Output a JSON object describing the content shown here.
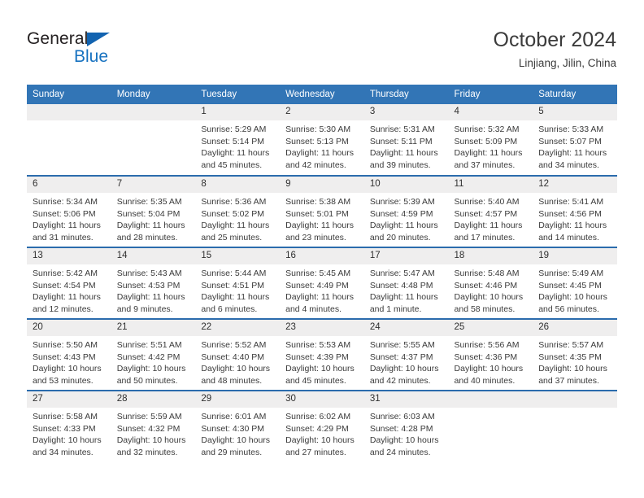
{
  "brand": {
    "name_part1": "General",
    "name_part2": "Blue",
    "colors": {
      "dark": "#231f20",
      "blue": "#1772c0",
      "triangle": "#1263b0"
    }
  },
  "header": {
    "title": "October 2024",
    "subtitle": "Linjiang, Jilin, China"
  },
  "theme": {
    "header_blue": "#3275b6",
    "row_divider_blue": "#2b6cad",
    "daynum_band": "#efeeee",
    "text": "#3a3a3a"
  },
  "weekday_headers": [
    "Sunday",
    "Monday",
    "Tuesday",
    "Wednesday",
    "Thursday",
    "Friday",
    "Saturday"
  ],
  "weeks": [
    [
      {
        "day": "",
        "sunrise": "",
        "sunset": "",
        "daylight1": "",
        "daylight2": "",
        "blank": true
      },
      {
        "day": "",
        "sunrise": "",
        "sunset": "",
        "daylight1": "",
        "daylight2": "",
        "blank": true
      },
      {
        "day": "1",
        "sunrise": "Sunrise: 5:29 AM",
        "sunset": "Sunset: 5:14 PM",
        "daylight1": "Daylight: 11 hours",
        "daylight2": "and 45 minutes."
      },
      {
        "day": "2",
        "sunrise": "Sunrise: 5:30 AM",
        "sunset": "Sunset: 5:13 PM",
        "daylight1": "Daylight: 11 hours",
        "daylight2": "and 42 minutes."
      },
      {
        "day": "3",
        "sunrise": "Sunrise: 5:31 AM",
        "sunset": "Sunset: 5:11 PM",
        "daylight1": "Daylight: 11 hours",
        "daylight2": "and 39 minutes."
      },
      {
        "day": "4",
        "sunrise": "Sunrise: 5:32 AM",
        "sunset": "Sunset: 5:09 PM",
        "daylight1": "Daylight: 11 hours",
        "daylight2": "and 37 minutes."
      },
      {
        "day": "5",
        "sunrise": "Sunrise: 5:33 AM",
        "sunset": "Sunset: 5:07 PM",
        "daylight1": "Daylight: 11 hours",
        "daylight2": "and 34 minutes."
      }
    ],
    [
      {
        "day": "6",
        "sunrise": "Sunrise: 5:34 AM",
        "sunset": "Sunset: 5:06 PM",
        "daylight1": "Daylight: 11 hours",
        "daylight2": "and 31 minutes."
      },
      {
        "day": "7",
        "sunrise": "Sunrise: 5:35 AM",
        "sunset": "Sunset: 5:04 PM",
        "daylight1": "Daylight: 11 hours",
        "daylight2": "and 28 minutes."
      },
      {
        "day": "8",
        "sunrise": "Sunrise: 5:36 AM",
        "sunset": "Sunset: 5:02 PM",
        "daylight1": "Daylight: 11 hours",
        "daylight2": "and 25 minutes."
      },
      {
        "day": "9",
        "sunrise": "Sunrise: 5:38 AM",
        "sunset": "Sunset: 5:01 PM",
        "daylight1": "Daylight: 11 hours",
        "daylight2": "and 23 minutes."
      },
      {
        "day": "10",
        "sunrise": "Sunrise: 5:39 AM",
        "sunset": "Sunset: 4:59 PM",
        "daylight1": "Daylight: 11 hours",
        "daylight2": "and 20 minutes."
      },
      {
        "day": "11",
        "sunrise": "Sunrise: 5:40 AM",
        "sunset": "Sunset: 4:57 PM",
        "daylight1": "Daylight: 11 hours",
        "daylight2": "and 17 minutes."
      },
      {
        "day": "12",
        "sunrise": "Sunrise: 5:41 AM",
        "sunset": "Sunset: 4:56 PM",
        "daylight1": "Daylight: 11 hours",
        "daylight2": "and 14 minutes."
      }
    ],
    [
      {
        "day": "13",
        "sunrise": "Sunrise: 5:42 AM",
        "sunset": "Sunset: 4:54 PM",
        "daylight1": "Daylight: 11 hours",
        "daylight2": "and 12 minutes."
      },
      {
        "day": "14",
        "sunrise": "Sunrise: 5:43 AM",
        "sunset": "Sunset: 4:53 PM",
        "daylight1": "Daylight: 11 hours",
        "daylight2": "and 9 minutes."
      },
      {
        "day": "15",
        "sunrise": "Sunrise: 5:44 AM",
        "sunset": "Sunset: 4:51 PM",
        "daylight1": "Daylight: 11 hours",
        "daylight2": "and 6 minutes."
      },
      {
        "day": "16",
        "sunrise": "Sunrise: 5:45 AM",
        "sunset": "Sunset: 4:49 PM",
        "daylight1": "Daylight: 11 hours",
        "daylight2": "and 4 minutes."
      },
      {
        "day": "17",
        "sunrise": "Sunrise: 5:47 AM",
        "sunset": "Sunset: 4:48 PM",
        "daylight1": "Daylight: 11 hours",
        "daylight2": "and 1 minute."
      },
      {
        "day": "18",
        "sunrise": "Sunrise: 5:48 AM",
        "sunset": "Sunset: 4:46 PM",
        "daylight1": "Daylight: 10 hours",
        "daylight2": "and 58 minutes."
      },
      {
        "day": "19",
        "sunrise": "Sunrise: 5:49 AM",
        "sunset": "Sunset: 4:45 PM",
        "daylight1": "Daylight: 10 hours",
        "daylight2": "and 56 minutes."
      }
    ],
    [
      {
        "day": "20",
        "sunrise": "Sunrise: 5:50 AM",
        "sunset": "Sunset: 4:43 PM",
        "daylight1": "Daylight: 10 hours",
        "daylight2": "and 53 minutes."
      },
      {
        "day": "21",
        "sunrise": "Sunrise: 5:51 AM",
        "sunset": "Sunset: 4:42 PM",
        "daylight1": "Daylight: 10 hours",
        "daylight2": "and 50 minutes."
      },
      {
        "day": "22",
        "sunrise": "Sunrise: 5:52 AM",
        "sunset": "Sunset: 4:40 PM",
        "daylight1": "Daylight: 10 hours",
        "daylight2": "and 48 minutes."
      },
      {
        "day": "23",
        "sunrise": "Sunrise: 5:53 AM",
        "sunset": "Sunset: 4:39 PM",
        "daylight1": "Daylight: 10 hours",
        "daylight2": "and 45 minutes."
      },
      {
        "day": "24",
        "sunrise": "Sunrise: 5:55 AM",
        "sunset": "Sunset: 4:37 PM",
        "daylight1": "Daylight: 10 hours",
        "daylight2": "and 42 minutes."
      },
      {
        "day": "25",
        "sunrise": "Sunrise: 5:56 AM",
        "sunset": "Sunset: 4:36 PM",
        "daylight1": "Daylight: 10 hours",
        "daylight2": "and 40 minutes."
      },
      {
        "day": "26",
        "sunrise": "Sunrise: 5:57 AM",
        "sunset": "Sunset: 4:35 PM",
        "daylight1": "Daylight: 10 hours",
        "daylight2": "and 37 minutes."
      }
    ],
    [
      {
        "day": "27",
        "sunrise": "Sunrise: 5:58 AM",
        "sunset": "Sunset: 4:33 PM",
        "daylight1": "Daylight: 10 hours",
        "daylight2": "and 34 minutes."
      },
      {
        "day": "28",
        "sunrise": "Sunrise: 5:59 AM",
        "sunset": "Sunset: 4:32 PM",
        "daylight1": "Daylight: 10 hours",
        "daylight2": "and 32 minutes."
      },
      {
        "day": "29",
        "sunrise": "Sunrise: 6:01 AM",
        "sunset": "Sunset: 4:30 PM",
        "daylight1": "Daylight: 10 hours",
        "daylight2": "and 29 minutes."
      },
      {
        "day": "30",
        "sunrise": "Sunrise: 6:02 AM",
        "sunset": "Sunset: 4:29 PM",
        "daylight1": "Daylight: 10 hours",
        "daylight2": "and 27 minutes."
      },
      {
        "day": "31",
        "sunrise": "Sunrise: 6:03 AM",
        "sunset": "Sunset: 4:28 PM",
        "daylight1": "Daylight: 10 hours",
        "daylight2": "and 24 minutes."
      },
      {
        "day": "",
        "sunrise": "",
        "sunset": "",
        "daylight1": "",
        "daylight2": "",
        "blank": true
      },
      {
        "day": "",
        "sunrise": "",
        "sunset": "",
        "daylight1": "",
        "daylight2": "",
        "blank": true
      }
    ]
  ]
}
